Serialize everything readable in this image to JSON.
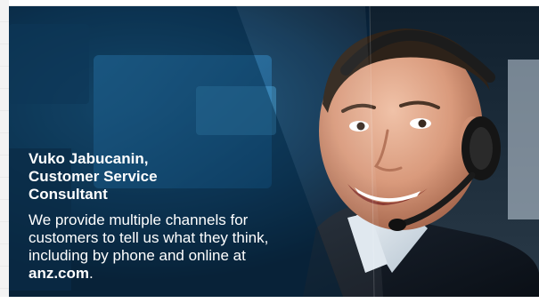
{
  "caption": {
    "name_title": "Vuko Jabucanin,\nCustomer Service\nConsultant",
    "body_prefix": "We provide multiple channels for customers to tell us what they think, including by phone and online at ",
    "body_link": "anz.com",
    "body_suffix": "."
  },
  "colors": {
    "overlay": "#0a2e4a",
    "text": "#ffffff"
  }
}
